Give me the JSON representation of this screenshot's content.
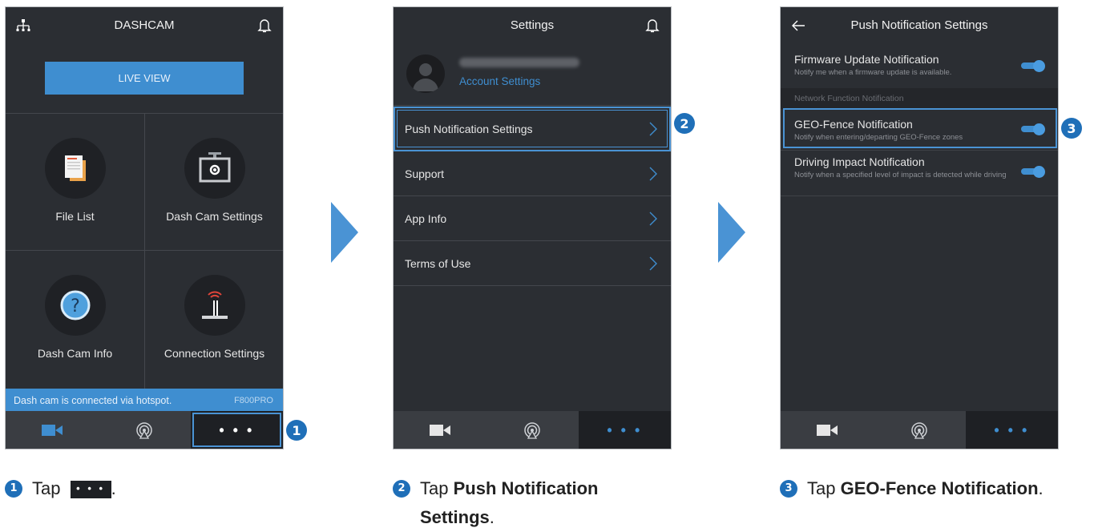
{
  "screen1": {
    "title": "DASHCAM",
    "live_view": "LIVE VIEW",
    "tiles": [
      "File List",
      "Dash Cam Settings",
      "Dash Cam Info",
      "Connection Settings"
    ],
    "status": "Dash cam is connected via hotspot.",
    "model": "F800PRO",
    "more": "• • •"
  },
  "screen2": {
    "title": "Settings",
    "account_settings": "Account Settings",
    "menu": [
      "Push Notification Settings",
      "Support",
      "App Info",
      "Terms of Use"
    ],
    "more": "• • •"
  },
  "screen3": {
    "title": "Push Notification Settings",
    "firmware": {
      "title": "Firmware Update Notification",
      "desc": "Notify me when a firmware update is available."
    },
    "section": "Network Function Notification",
    "geofence": {
      "title": "GEO-Fence Notification",
      "desc": "Notify when entering/departing GEO-Fence zones"
    },
    "impact": {
      "title": "Driving Impact Notification",
      "desc": "Notify when a specified level of impact is detected while driving"
    },
    "more": "• • •"
  },
  "steps": {
    "n1": "1",
    "n2": "2",
    "n3": "3",
    "tap": "Tap",
    "dots": "• • •",
    "step1_end": ".",
    "step2_target": "Push Notification",
    "step2_target2": "Settings",
    "step2_end": ".",
    "step3_target": "GEO-Fence Notification",
    "step3_end": "."
  },
  "colors": {
    "accent": "#3f8ed0",
    "phone_bg": "#2b2e33",
    "highlight": "#4a93d4",
    "badge": "#1f6fb8"
  }
}
